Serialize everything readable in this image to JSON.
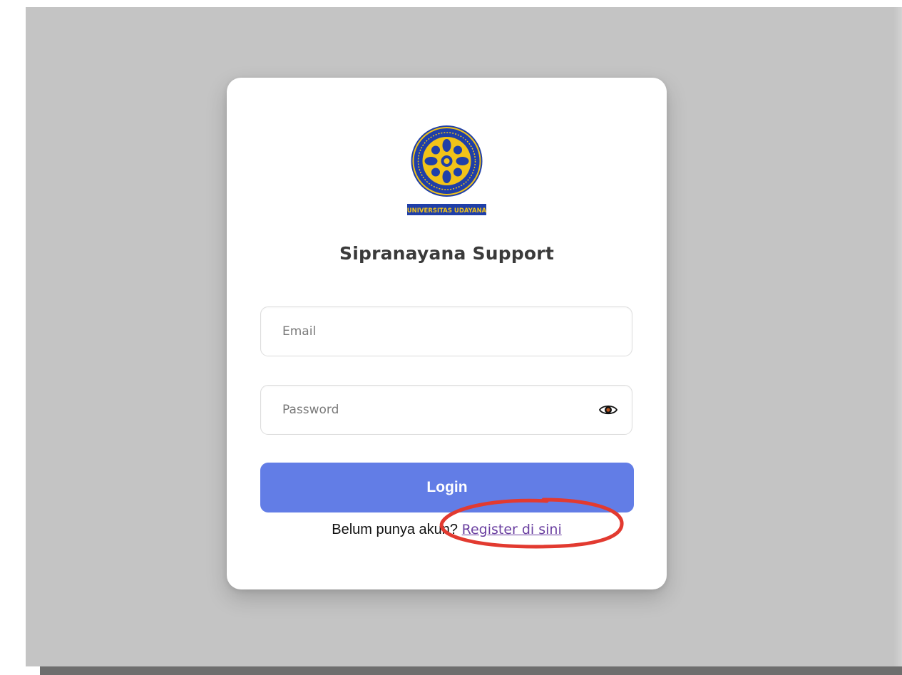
{
  "logo": {
    "name": "universitas-udayana-logo",
    "banner_text": "UNIVERSITAS UDAYANA"
  },
  "login_form": {
    "title": "Sipranayana Support",
    "email_placeholder": "Email",
    "password_placeholder": "Password",
    "toggle_icon": "eye-icon",
    "login_label": "Login",
    "register_prompt": "Belum punya akun?",
    "register_link": "Register di sini"
  },
  "colors": {
    "background": "#c4c4c4",
    "login_button": "#627de6",
    "link": "#6a3fa0",
    "logo_blue": "#1f3fa8",
    "logo_gold": "#f2c318",
    "annotation": "#e23a30"
  },
  "annotation": {
    "type": "red-circle",
    "highlights": "register_link"
  }
}
